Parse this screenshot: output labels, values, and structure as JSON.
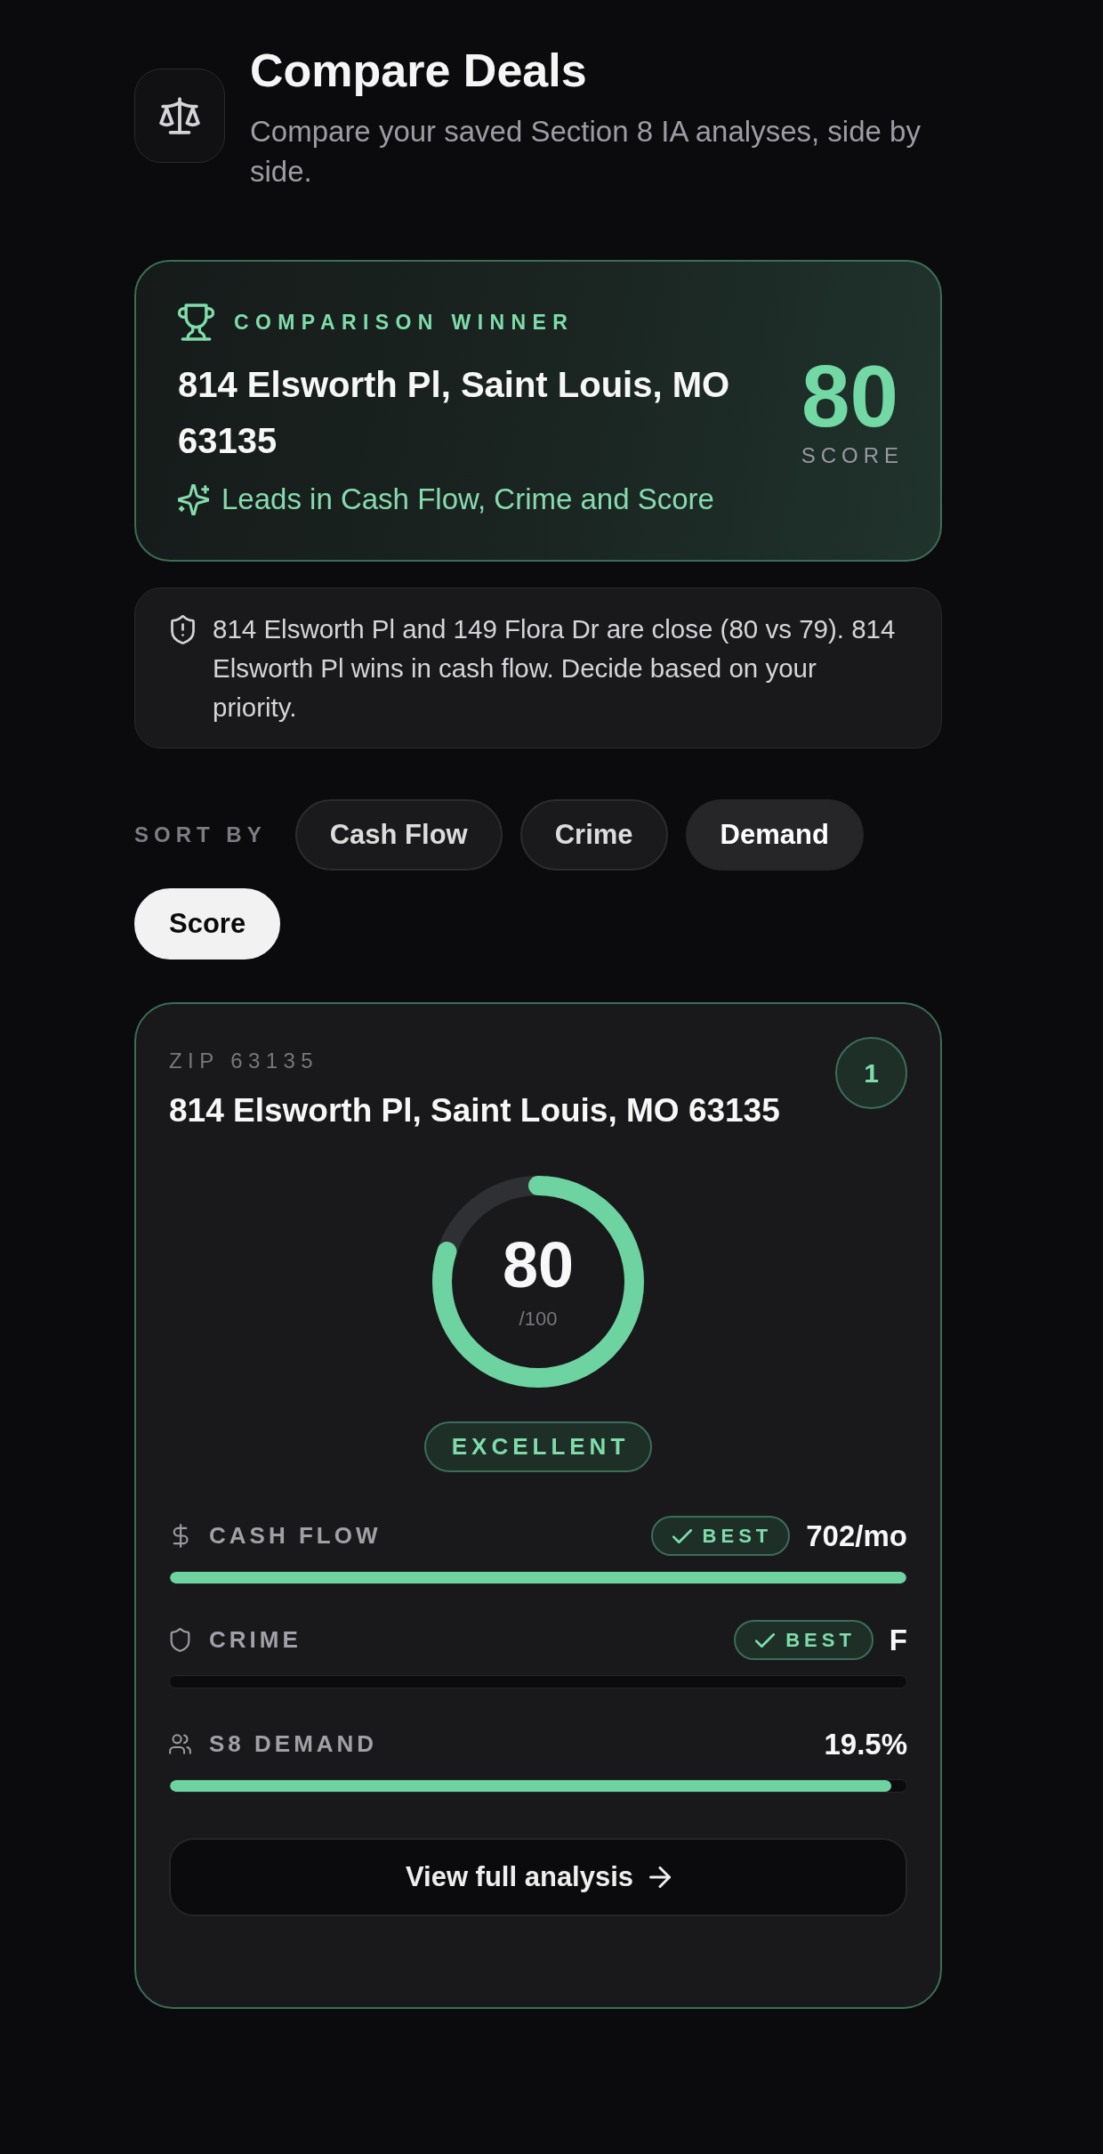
{
  "header": {
    "title": "Compare Deals",
    "subtitle": "Compare your saved Section 8 IA analyses, side by side."
  },
  "winner": {
    "label": "COMPARISON WINNER",
    "address": "814 Elsworth Pl, Saint Louis, MO 63135",
    "reason": "Leads in Cash Flow, Crime and Score",
    "score": "80",
    "score_label": "SCORE"
  },
  "note": {
    "text": "814 Elsworth Pl and 149 Flora Dr are close (80 vs 79). 814 Elsworth Pl wins in cash flow. Decide based on your priority."
  },
  "sort": {
    "label": "SORT BY",
    "options": [
      {
        "label": "Cash Flow",
        "selected": false,
        "hovered": false
      },
      {
        "label": "Crime",
        "selected": false,
        "hovered": false
      },
      {
        "label": "Demand",
        "selected": false,
        "hovered": true
      },
      {
        "label": "Score",
        "selected": true,
        "hovered": false
      }
    ]
  },
  "deals": [
    {
      "zip": "ZIP 63135",
      "address": "814 Elsworth Pl, Saint Louis, MO 63135",
      "rank": "1",
      "score_ring": {
        "value": "80",
        "max": "/100",
        "level": 0.8
      },
      "rating": "EXCELLENT",
      "metrics": [
        {
          "kind": "cash_flow",
          "label": "CASH FLOW",
          "badge": "BEST",
          "value": "702/mo",
          "level": 1.0
        },
        {
          "kind": "crime",
          "label": "CRIME",
          "badge": "BEST",
          "value": "F",
          "level": 0
        },
        {
          "kind": "demand",
          "label": "S8 DEMAND",
          "value": "19.5%",
          "level": 0.98
        }
      ],
      "action": "View full analysis"
    }
  ]
}
